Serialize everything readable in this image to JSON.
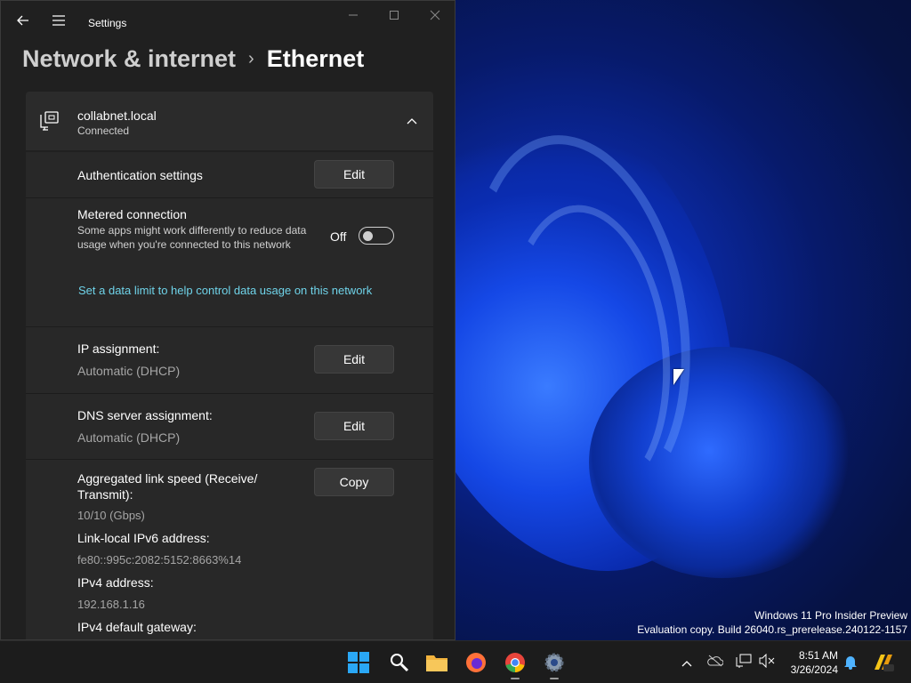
{
  "window": {
    "app_title": "Settings",
    "back_icon": "arrow-left-icon",
    "menu_icon": "hamburger-icon"
  },
  "breadcrumb": {
    "parent": "Network & internet",
    "separator": "›",
    "current": "Ethernet"
  },
  "network": {
    "name": "collabnet.local",
    "status": "Connected",
    "icon": "ethernet-icon"
  },
  "settings": {
    "auth_label": "Authentication settings",
    "auth_button": "Edit",
    "metered_label": "Metered connection",
    "metered_desc": "Some apps might work differently to reduce data usage when you're connected to this network",
    "metered_state": "Off",
    "metered_on": false,
    "data_limit_link": "Set a data limit to help control data usage on this network",
    "ip_assignment_label": "IP assignment:",
    "ip_assignment_value": "Automatic (DHCP)",
    "ip_assignment_button": "Edit",
    "dns_label": "DNS server assignment:",
    "dns_value": "Automatic (DHCP)",
    "dns_button": "Edit",
    "link_speed_label": "Aggregated link speed (Receive/ Transmit):",
    "link_speed_value": "10/10 (Gbps)",
    "copy_button": "Copy",
    "ipv6_label": "Link-local IPv6 address:",
    "ipv6_value": "fe80::995c:2082:5152:8663%14",
    "ipv4_label": "IPv4 address:",
    "ipv4_value": "192.168.1.16",
    "gateway_label": "IPv4 default gateway:"
  },
  "desktop": {
    "watermark_line1": "Windows 11 Pro Insider Preview",
    "watermark_line2": "Evaluation copy. Build 26040.rs_prerelease.240122-1157"
  },
  "taskbar": {
    "apps": [
      "start-icon",
      "search-icon",
      "file-explorer-icon",
      "firefox-icon",
      "chrome-icon",
      "settings-icon"
    ],
    "tray": [
      "chevron-up-icon",
      "onedrive-icon",
      "network-icon",
      "volume-muted-icon",
      "bell-icon",
      "copilot-icon"
    ],
    "time": "8:51 AM",
    "date": "3/26/2024"
  },
  "colors": {
    "window_bg": "#202020",
    "card_bg": "#2b2b2b",
    "link": "#6fd3e9",
    "taskbar_bg": "#1c1c1c"
  }
}
